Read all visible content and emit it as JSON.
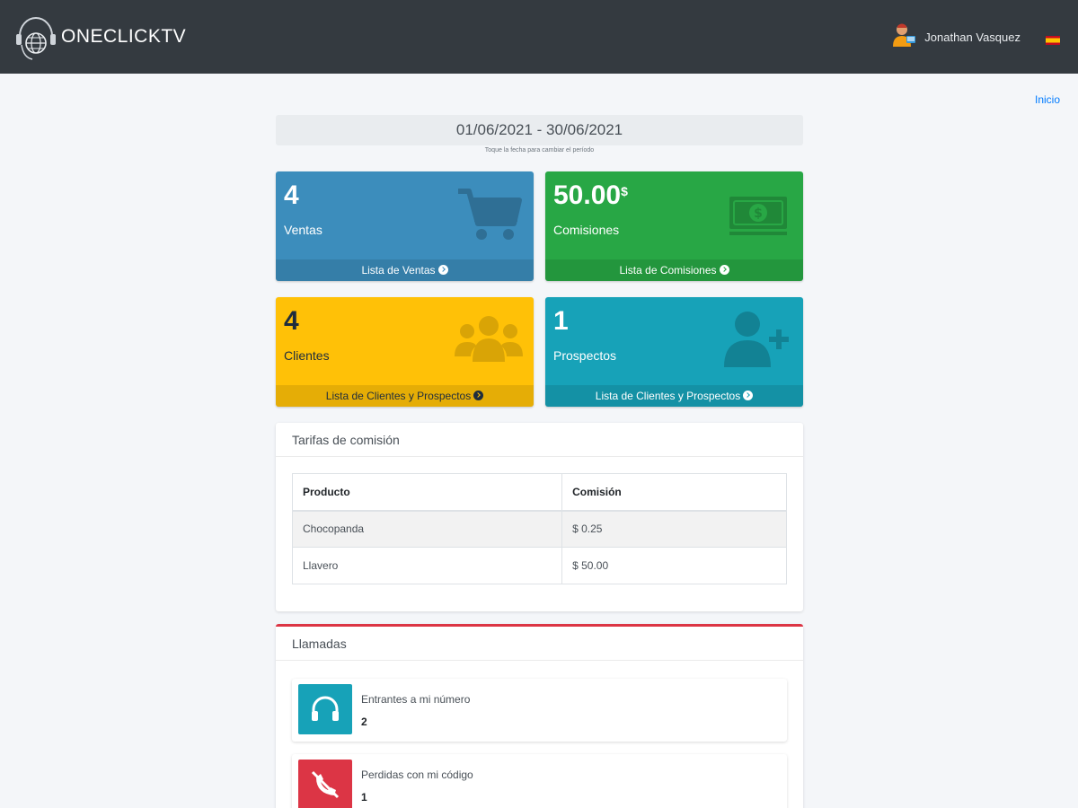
{
  "header": {
    "brand": "ONECLICKTV",
    "user_name": "Jonathan Vasquez",
    "language_icon": "spain-flag-icon"
  },
  "breadcrumb": {
    "home": "Inicio"
  },
  "date_filter": {
    "range": "01/06/2021 - 30/06/2021",
    "hint": "Toque la fecha para cambiar el período"
  },
  "stats": {
    "ventas": {
      "value": "4",
      "label": "Ventas",
      "link": "Lista de Ventas",
      "icon": "cart-icon",
      "color": "#3c8dbc"
    },
    "comisiones": {
      "value": "50.00",
      "unit": "$",
      "label": "Comisiones",
      "link": "Lista de Comisiones",
      "icon": "money-bill-icon",
      "color": "#28a745"
    },
    "clientes": {
      "value": "4",
      "label": "Clientes",
      "link": "Lista de Clientes y Prospectos",
      "icon": "users-icon",
      "color": "#ffc107"
    },
    "prospectos": {
      "value": "1",
      "label": "Prospectos",
      "link": "Lista de Clientes y Prospectos",
      "icon": "user-plus-icon",
      "color": "#17a2b8"
    }
  },
  "tarifas": {
    "title": "Tarifas de comisión",
    "columns": [
      "Producto",
      "Comisión"
    ],
    "rows": [
      [
        "Chocopanda",
        "$ 0.25"
      ],
      [
        "Llavero",
        "$ 50.00"
      ]
    ]
  },
  "llamadas": {
    "title": "Llamadas",
    "items": [
      {
        "label": "Entrantes a mi número",
        "value": "2",
        "icon": "headphones-icon",
        "color": "#17a2b8"
      },
      {
        "label": "Perdidas con mi código",
        "value": "1",
        "icon": "phone-slash-icon",
        "color": "#dc3545"
      }
    ]
  }
}
